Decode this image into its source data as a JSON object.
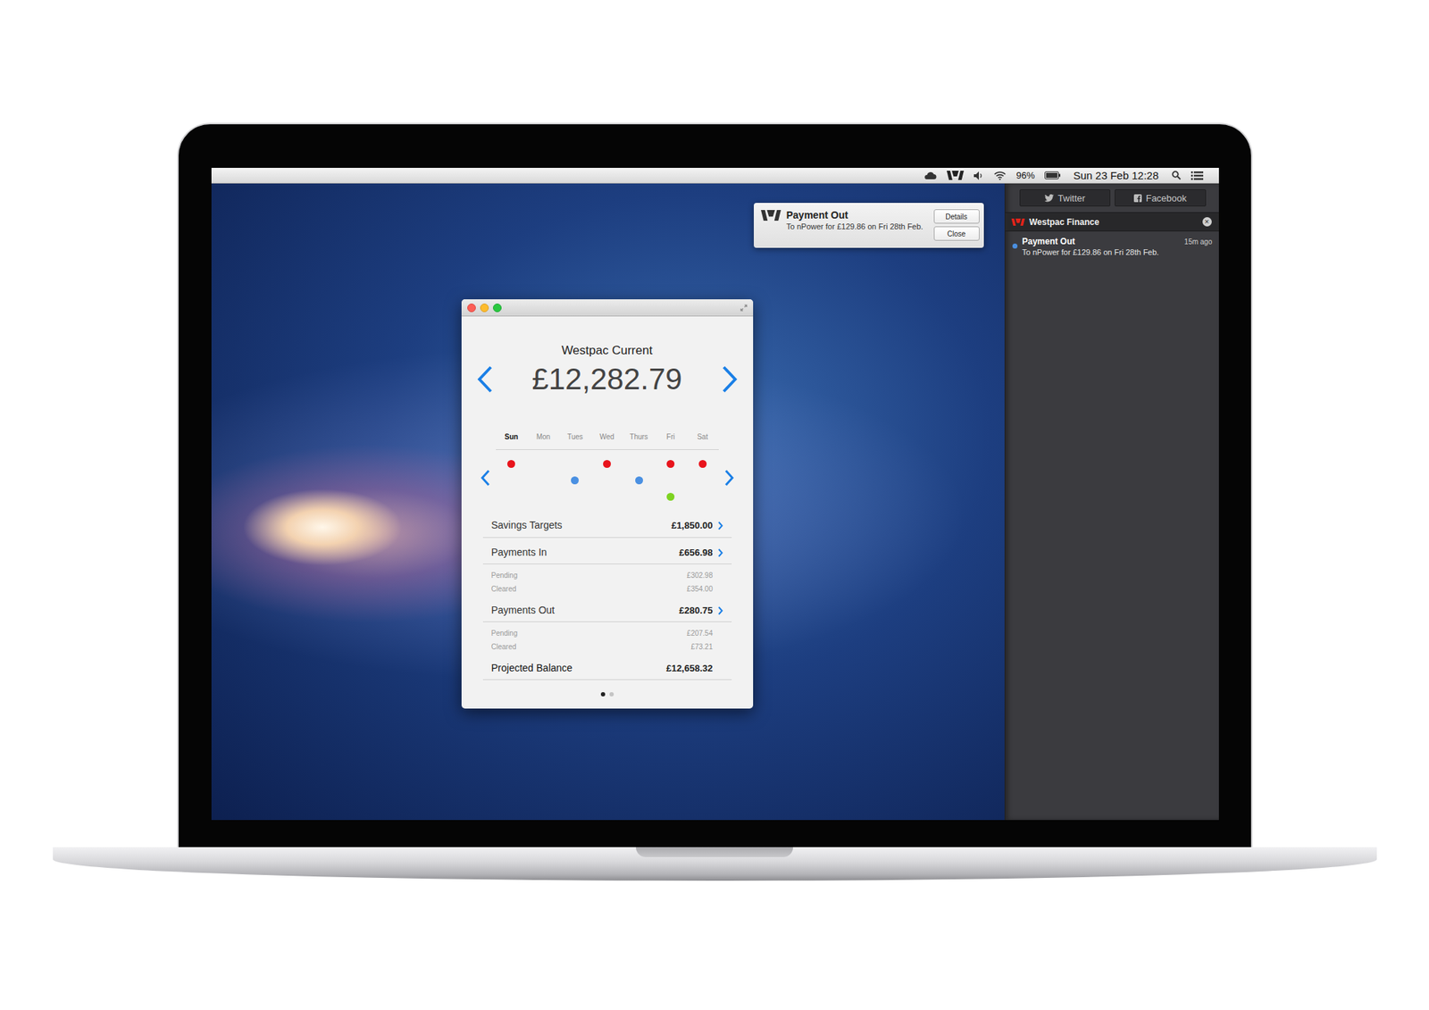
{
  "menubar": {
    "battery": "96%",
    "clock": "Sun 23 Feb 12:28"
  },
  "banner": {
    "title": "Payment Out",
    "body": "To nPower for £129.86 on Fri 28th Feb.",
    "buttons": [
      "Details",
      "Close"
    ]
  },
  "notification_center": {
    "tabs": [
      {
        "label": "Twitter",
        "kind": "twitter"
      },
      {
        "label": "Facebook",
        "kind": "facebook"
      }
    ],
    "group": {
      "title": "Westpac Finance",
      "close": "×",
      "items": [
        {
          "title": "Payment Out",
          "time": "15m ago",
          "body": "To nPower for £129.86 on Fri 28th Feb.",
          "unread": true
        }
      ]
    }
  },
  "account_window": {
    "title": "Westpac Current",
    "balance": "£12,282.79",
    "days": [
      {
        "label": "Sun",
        "selected": true,
        "entries": [
          {
            "kind": "out",
            "color": "#e8141c"
          }
        ]
      },
      {
        "label": "Mon",
        "selected": false,
        "entries": []
      },
      {
        "label": "Tues",
        "selected": false,
        "entries": [
          {
            "kind": "in",
            "color": "#4a90e2"
          }
        ]
      },
      {
        "label": "Wed",
        "selected": false,
        "entries": [
          {
            "kind": "out",
            "color": "#e8141c"
          }
        ]
      },
      {
        "label": "Thurs",
        "selected": false,
        "entries": [
          {
            "kind": "in",
            "color": "#4a90e2"
          }
        ]
      },
      {
        "label": "Fri",
        "selected": false,
        "entries": [
          {
            "kind": "out",
            "color": "#e8141c"
          },
          {
            "kind": "saving",
            "color": "#7ed321"
          }
        ]
      },
      {
        "label": "Sat",
        "selected": false,
        "entries": [
          {
            "kind": "out",
            "color": "#e8141c"
          }
        ]
      }
    ],
    "rows": [
      {
        "kind": "main",
        "label": "Savings Targets",
        "amount": "£1,850.00",
        "link": true
      },
      {
        "kind": "main",
        "label": "Payments In",
        "amount": "£656.98",
        "link": true
      },
      {
        "kind": "sub",
        "label": "Pending",
        "amount": "£302.98",
        "link": false
      },
      {
        "kind": "sub",
        "label": "Cleared",
        "amount": "£354.00",
        "link": false
      },
      {
        "kind": "main",
        "label": "Payments Out",
        "amount": "£280.75",
        "link": true
      },
      {
        "kind": "sub",
        "label": "Pending",
        "amount": "£207.54",
        "link": false
      },
      {
        "kind": "sub",
        "label": "Cleared",
        "amount": "£73.21",
        "link": false
      },
      {
        "kind": "total",
        "label": "Projected Balance",
        "amount": "£12,658.32",
        "link": false
      }
    ],
    "pages": [
      {
        "selected": true
      },
      {
        "selected": false
      }
    ]
  }
}
